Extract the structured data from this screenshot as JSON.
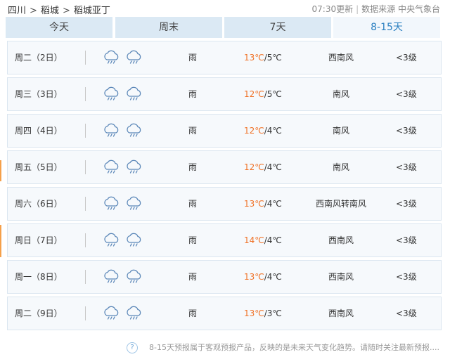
{
  "breadcrumb": {
    "province": "四川",
    "county": "稻城",
    "place": "稻城亚丁",
    "separator": ">"
  },
  "meta": {
    "update_time": "07:30更新",
    "divider": "|",
    "source": "数据来源 中央气象台"
  },
  "tabs": [
    {
      "label": "今天",
      "active": false
    },
    {
      "label": "周末",
      "active": false
    },
    {
      "label": "7天",
      "active": false
    },
    {
      "label": "8-15天",
      "active": true
    }
  ],
  "icons": {
    "day": "rain-cloud-icon",
    "night": "rain-cloud-icon"
  },
  "colors": {
    "high_temp": "#f07227",
    "tab_active_text": "#2a7fc0",
    "tab_bg": "#dbe9f4"
  },
  "rows": [
    {
      "day": "周二（2日）",
      "condition": "雨",
      "high": "13℃",
      "low": "/5℃",
      "wind": "西南风",
      "level": "<3级"
    },
    {
      "day": "周三（3日）",
      "condition": "雨",
      "high": "12℃",
      "low": "/5℃",
      "wind": "南风",
      "level": "<3级"
    },
    {
      "day": "周四（4日）",
      "condition": "雨",
      "high": "12℃",
      "low": "/4℃",
      "wind": "南风",
      "level": "<3级"
    },
    {
      "day": "周五（5日）",
      "condition": "雨",
      "high": "12℃",
      "low": "/4℃",
      "wind": "南风",
      "level": "<3级"
    },
    {
      "day": "周六（6日）",
      "condition": "雨",
      "high": "13℃",
      "low": "/4℃",
      "wind": "西南风转南风",
      "level": "<3级"
    },
    {
      "day": "周日（7日）",
      "condition": "雨",
      "high": "14℃",
      "low": "/4℃",
      "wind": "西南风",
      "level": "<3级"
    },
    {
      "day": "周一（8日）",
      "condition": "雨",
      "high": "13℃",
      "low": "/4℃",
      "wind": "西南风",
      "level": "<3级"
    },
    {
      "day": "周二（9日）",
      "condition": "雨",
      "high": "13℃",
      "low": "/3℃",
      "wind": "西南风",
      "level": "<3级"
    }
  ],
  "footer": {
    "help": "?",
    "text": "8-15天预报属于客观预报产品，反映的是未来天气变化趋势。请随时关注最新预报...."
  }
}
